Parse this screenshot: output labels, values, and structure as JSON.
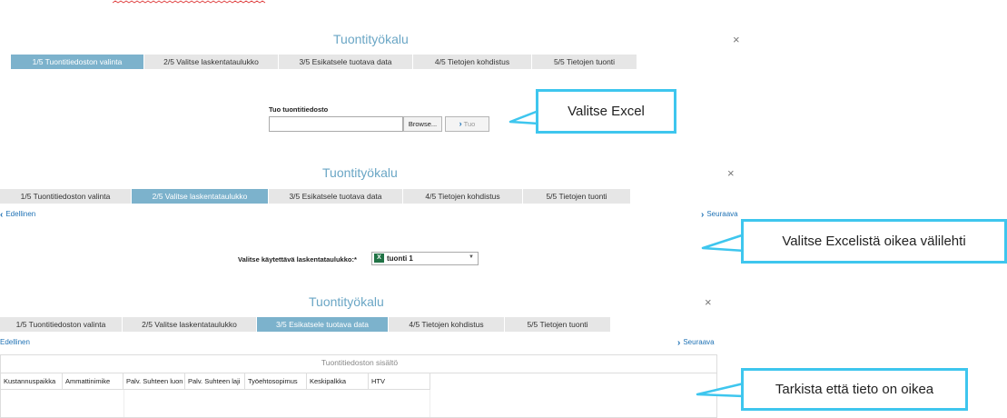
{
  "dialog_title": "Tuontityökalu",
  "tabs": [
    "1/5 Tuontitiedoston valinta",
    "2/5 Valitse laskentataulukko",
    "3/5 Esikatsele tuotava data",
    "4/5 Tietojen kohdistus",
    "5/5 Tietojen tuonti"
  ],
  "close_glyph": "×",
  "accent_color": "#7cb2cc",
  "callout_border_color": "#3ec6ee",
  "step1": {
    "file_label": "Tuo tuontitiedosto",
    "file_value": "",
    "browse_label": "Browse...",
    "import_label": "Tuo",
    "callout": "Valitse Excel"
  },
  "step2": {
    "prev_label": "Edellinen",
    "next_label": "Seuraava",
    "sheet_label": "Valitse käytettävä laskentataulukko:*",
    "sheet_icon": "excel-icon",
    "sheet_value": "tuonti 1",
    "callout": "Valitse Excelistä oikea välilehti"
  },
  "step3": {
    "prev_label": "Edellinen",
    "next_label": "Seuraava",
    "grid_title": "Tuontitiedoston sisältö",
    "columns": [
      "Kustannuspaikka",
      "Ammattinimike",
      "Palv. Suhteen luon",
      "Palv. Suhteen laji",
      "Työehtosopimus",
      "Keskipalkka",
      "HTV"
    ],
    "callout": "Tarkista että tieto on oikea"
  }
}
